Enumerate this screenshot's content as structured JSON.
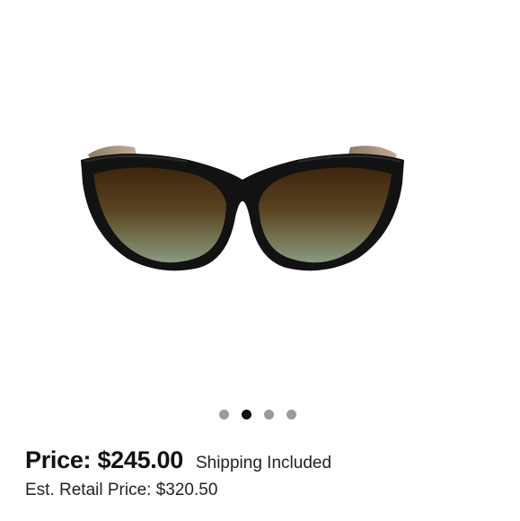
{
  "product": {
    "image_icon": "sunglasses-image",
    "carousel": {
      "count": 4,
      "active_index": 1
    }
  },
  "pricing": {
    "price_label": "Price: $245.00",
    "shipping_label": "Shipping Included",
    "retail_label": "Est. Retail Price: $320.50"
  },
  "colors": {
    "dot_inactive": "#9a9a9a",
    "dot_active": "#111111",
    "frame": "#121212",
    "lens_top": "#4a2e12",
    "lens_bottom": "#7e8a6e"
  }
}
